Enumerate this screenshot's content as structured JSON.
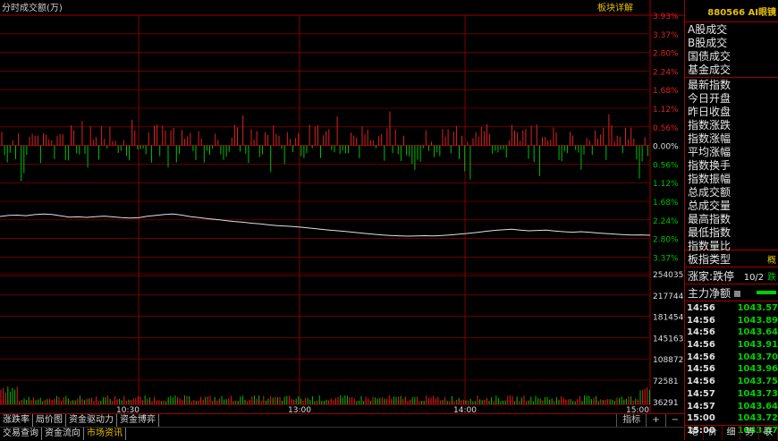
{
  "header": {
    "mode_label": "分时",
    "indicator_label": "成交额(万)",
    "sector_detail_label": "板块详解",
    "code_title": "880566 AI眼镜"
  },
  "chart_data": {
    "type": "line",
    "x_axis_labels": [
      "10:30",
      "13:00",
      "14:00",
      "15:00"
    ],
    "upper_axis_labels": [
      "3.93%",
      "3.37%",
      "2.80%",
      "2.24%",
      "1.68%",
      "1.12%",
      "0.56%",
      "0.00%",
      "0.56%",
      "1.12%",
      "1.68%",
      "2.24%",
      "2.80%",
      "3.37%"
    ],
    "volume_axis_labels": [
      "254035",
      "217744",
      "181454",
      "145163",
      "108872",
      "72581",
      "36291"
    ],
    "price_line": [
      0.42,
      0.3,
      0.28,
      0.34,
      0.22,
      0.15,
      0.2,
      0.36,
      0.5,
      0.46,
      0.52,
      0.44,
      0.38,
      0.46,
      0.55,
      0.6,
      0.56,
      0.4,
      0.3,
      0.2,
      0.15,
      0.28,
      0.44,
      0.55,
      0.66,
      0.75,
      0.86,
      0.96,
      1.04,
      1.14,
      1.22,
      1.33,
      1.4,
      1.46,
      1.52,
      1.6,
      1.7,
      1.8,
      1.88,
      1.96,
      2.05,
      2.14,
      2.24,
      2.32,
      2.4,
      2.46,
      2.5,
      2.54,
      2.52,
      2.49,
      2.52,
      2.46,
      2.4,
      2.33,
      2.24,
      2.14,
      2.02,
      1.92,
      1.86,
      1.8,
      1.88,
      1.96,
      1.92,
      1.88,
      1.98,
      2.06,
      2.12,
      2.06,
      2.12,
      2.2,
      2.26,
      2.32,
      2.38,
      2.42,
      2.4,
      2.44
    ]
  },
  "right_panel": {
    "items_group1": [
      "A股成交",
      "B股成交",
      "国债成交",
      "基金成交"
    ],
    "items_group2": [
      "最新指数",
      "今日开盘",
      "昨日收盘",
      "指数涨跌",
      "指数涨幅",
      "平均涨幅",
      "指数换手",
      "指数振幅",
      "总成交额",
      "总成交量",
      "最高指数",
      "最低指数",
      "指数量比"
    ],
    "board_type_label": "板指类型",
    "board_type_value": "概",
    "limit_label": "涨家:跌停",
    "limit_value": "10/2",
    "limit_suffix": "跌",
    "net_flow_label": "主力净额",
    "ticks": [
      {
        "time": "14:56",
        "price": "1043.57"
      },
      {
        "time": "14:56",
        "price": "1043.89"
      },
      {
        "time": "14:56",
        "price": "1043.64"
      },
      {
        "time": "14:56",
        "price": "1043.91"
      },
      {
        "time": "14:56",
        "price": "1043.70"
      },
      {
        "time": "14:56",
        "price": "1043.96"
      },
      {
        "time": "14:56",
        "price": "1043.75"
      },
      {
        "time": "14:57",
        "price": "1043.73"
      },
      {
        "time": "14:57",
        "price": "1043.64"
      },
      {
        "time": "15:00",
        "price": "1043.72"
      },
      {
        "time": "15:00",
        "price": "1043.67"
      }
    ],
    "bottom_tabs": [
      "笔",
      "价",
      "细",
      "势",
      "联"
    ]
  },
  "bottom_bar": {
    "tabs_row1": [
      "涨跌率",
      "局价图",
      "资金驱动力",
      "资金博弈"
    ],
    "tabs_row2": [
      "交易查询",
      "资金流向",
      "市场资讯"
    ],
    "indicator_button": "指标",
    "zoom_in": "+",
    "zoom_out": "−"
  },
  "colors": {
    "up": "#e02020",
    "down": "#00c000",
    "grid": "#a00000",
    "line": "#e0e0e0",
    "accent": "#e8c000"
  }
}
